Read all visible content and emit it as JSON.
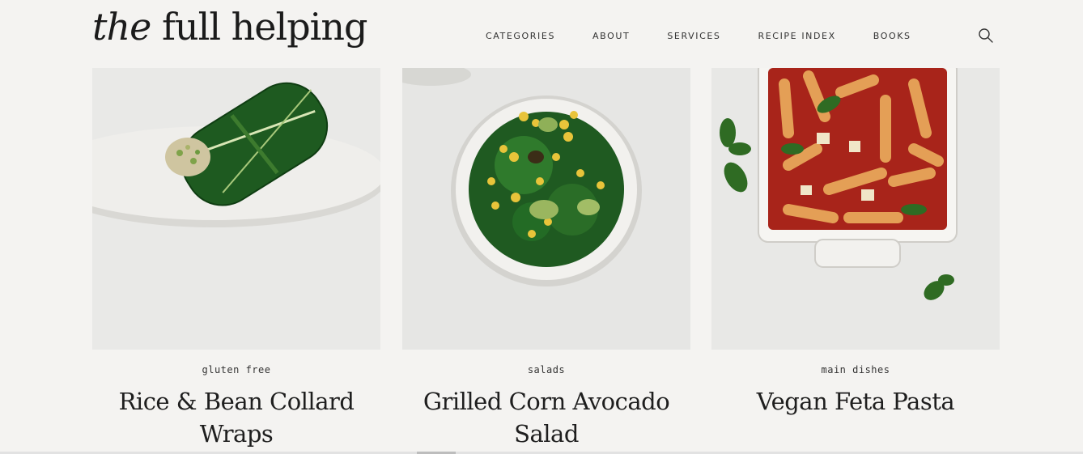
{
  "header": {
    "logo_part1": "the",
    "logo_part2": " full helping",
    "nav": [
      "CATEGORIES",
      "ABOUT",
      "SERVICES",
      "RECIPE INDEX",
      "BOOKS"
    ],
    "search_icon": "search-icon"
  },
  "cards": [
    {
      "category": "gluten free",
      "title": "Rice & Bean Collard Wraps"
    },
    {
      "category": "salads",
      "title": "Grilled Corn Avocado Salad"
    },
    {
      "category": "main dishes",
      "title": "Vegan Feta Pasta"
    }
  ],
  "colors": {
    "background": "#f4f3f1",
    "text": "#1e1e1e",
    "plate": "#ecebe8"
  }
}
